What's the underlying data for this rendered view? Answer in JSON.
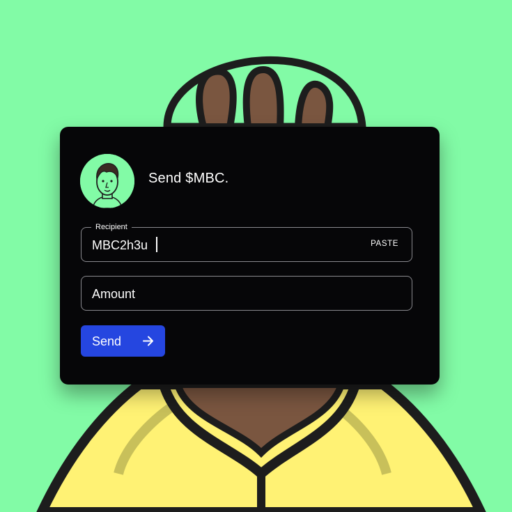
{
  "background": {
    "color": "#82fba6"
  },
  "header": {
    "title": "Send $MBC."
  },
  "recipient": {
    "legend": "Recipient",
    "value": "MBC2h3u",
    "paste_label": "PASTE"
  },
  "amount": {
    "placeholder": "Amount"
  },
  "send_button": {
    "label": "Send",
    "color": "#2546e0",
    "icon": "arrow-right-icon"
  },
  "avatar": {
    "icon": "character-avatar"
  }
}
